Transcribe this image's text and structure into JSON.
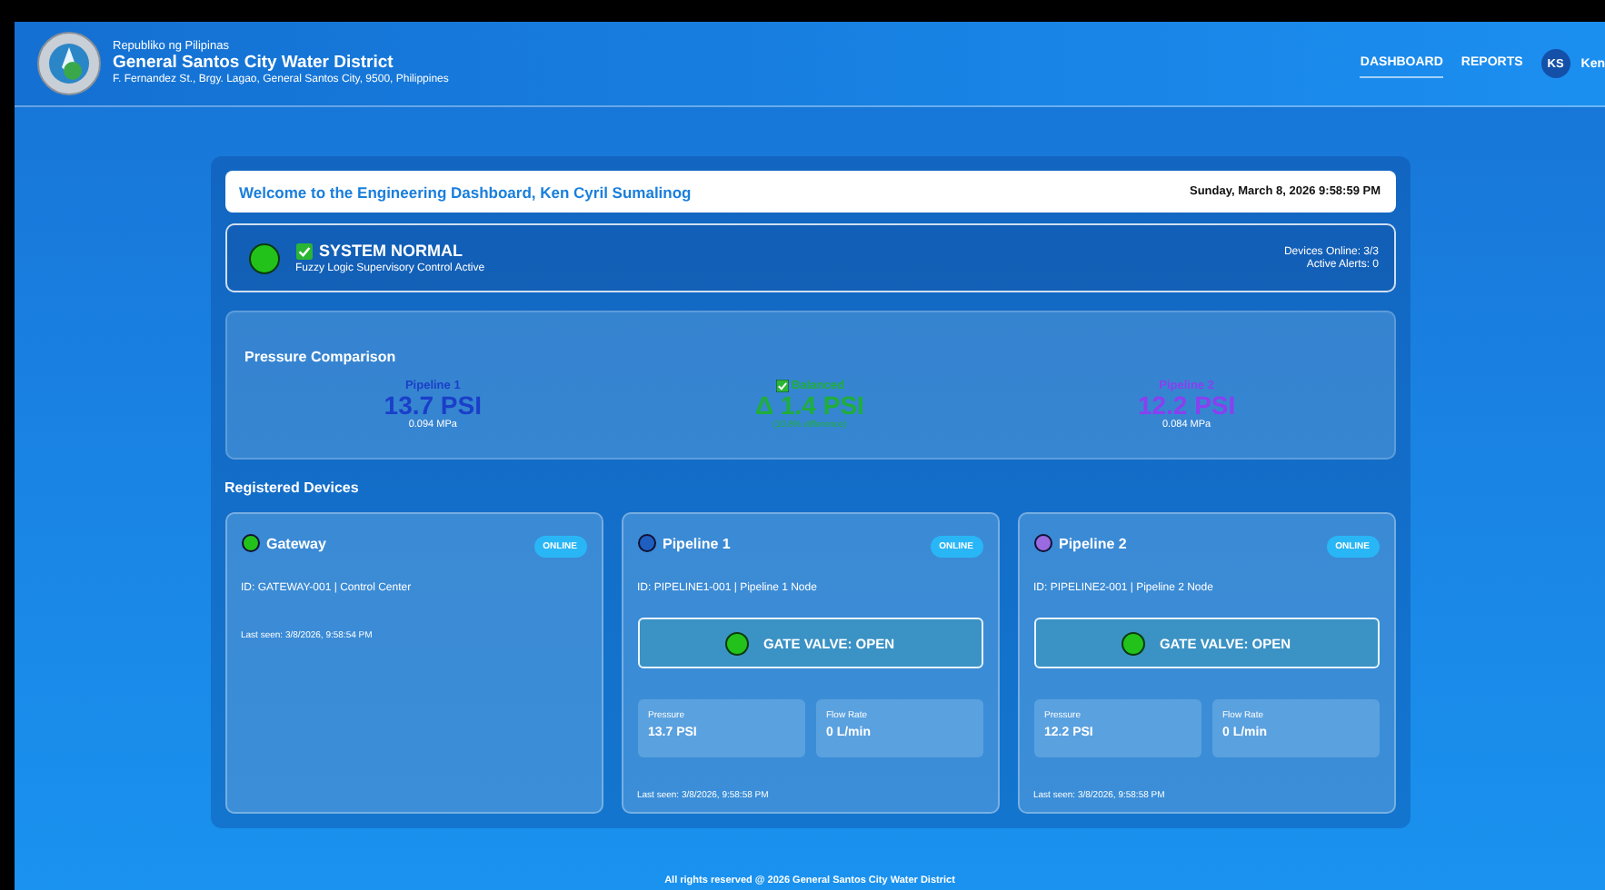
{
  "header": {
    "republic": "Republiko ng Pilipinas",
    "org": "General Santos City Water District",
    "address": "F. Fernandez St., Brgy. Lagao, General Santos City, 9500, Philippines",
    "nav": [
      {
        "label": "DASHBOARD",
        "selected": true
      },
      {
        "label": "REPORTS",
        "selected": false
      }
    ],
    "user": {
      "initials": "KS",
      "name": "Ken"
    }
  },
  "welcome": {
    "text": "Welcome to the Engineering Dashboard, Ken Cyril Sumalinog",
    "datetime": "Sunday, March 8, 2026 9:58:59 PM"
  },
  "status": {
    "title": "SYSTEM NORMAL",
    "subtitle": "Fuzzy Logic Supervisory Control Active",
    "devices_online": "Devices Online: 3/3",
    "alerts": "Active Alerts: 0",
    "color": "#22c21a"
  },
  "pressure": {
    "title": "Pressure Comparison",
    "left": {
      "label": "Pipeline 1",
      "value": "13.7 PSI",
      "sub": "0.094 MPa",
      "color": "#1a3fc8"
    },
    "center": {
      "label": "Balanced",
      "value": "Δ 1.4 PSI",
      "sub": "(10.8% difference)",
      "color": "#1fae3a"
    },
    "right": {
      "label": "Pipeline 2",
      "value": "12.2 PSI",
      "sub": "0.084 MPa",
      "color": "#8a3ff0"
    }
  },
  "devices_title": "Registered Devices",
  "devices": [
    {
      "kind": "gateway",
      "name": "Gateway",
      "color": "#22c21a",
      "status": "ONLINE",
      "id": "ID: GATEWAY-001 | Control Center",
      "last_seen": "Last seen: 3/8/2026, 9:58:54 PM"
    },
    {
      "kind": "pipeline",
      "name": "Pipeline 1",
      "color": "#1e5fc0",
      "status": "ONLINE",
      "id": "ID: PIPELINE1-001 | Pipeline 1 Node",
      "valve": "GATE VALVE: OPEN",
      "valve_open": true,
      "metrics": [
        {
          "label": "Pressure",
          "value": "13.7 PSI"
        },
        {
          "label": "Flow Rate",
          "value": "0 L/min"
        }
      ],
      "last_seen": "Last seen: 3/8/2026, 9:58:58 PM"
    },
    {
      "kind": "pipeline",
      "name": "Pipeline 2",
      "color": "#9a6ae0",
      "status": "ONLINE",
      "id": "ID: PIPELINE2-001 | Pipeline 2 Node",
      "valve": "GATE VALVE: OPEN",
      "valve_open": true,
      "metrics": [
        {
          "label": "Pressure",
          "value": "12.2 PSI"
        },
        {
          "label": "Flow Rate",
          "value": "0 L/min"
        }
      ],
      "last_seen": "Last seen: 3/8/2026, 9:58:58 PM"
    }
  ],
  "footer": "All rights reserved @ 2026 General Santos City Water District"
}
